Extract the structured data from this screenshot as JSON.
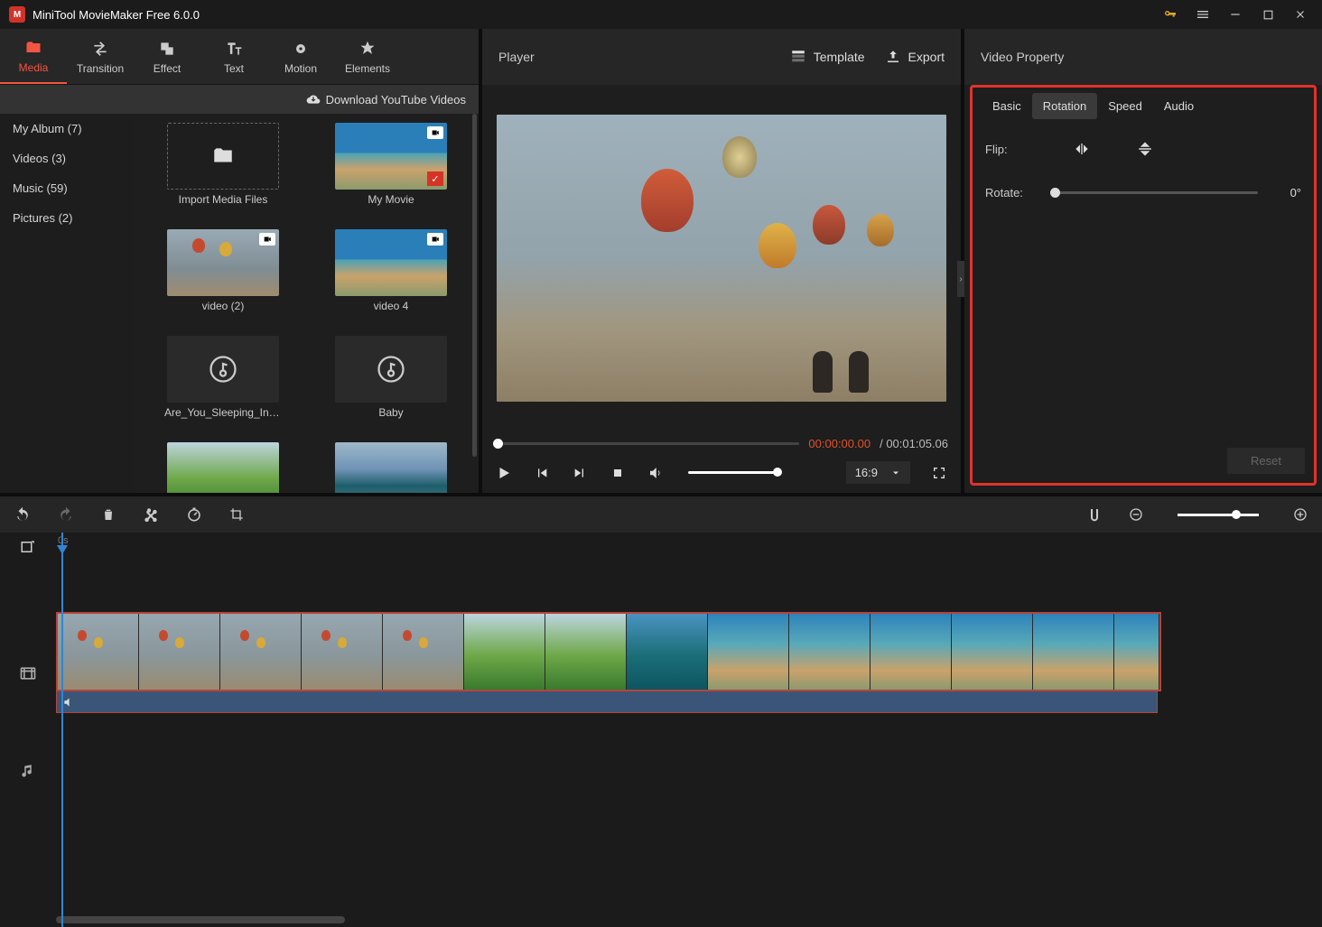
{
  "app": {
    "title": "MiniTool MovieMaker Free 6.0.0"
  },
  "tool_tabs": [
    {
      "id": "media",
      "label": "Media"
    },
    {
      "id": "transition",
      "label": "Transition"
    },
    {
      "id": "effect",
      "label": "Effect"
    },
    {
      "id": "text",
      "label": "Text"
    },
    {
      "id": "motion",
      "label": "Motion"
    },
    {
      "id": "elements",
      "label": "Elements"
    }
  ],
  "media": {
    "active_category": "My Album (7)",
    "categories": [
      {
        "label": "My Album (7)"
      },
      {
        "label": "Videos (3)"
      },
      {
        "label": "Music (59)"
      },
      {
        "label": "Pictures (2)"
      }
    ],
    "download_label": "Download YouTube Videos",
    "items": [
      {
        "label": "Import Media Files",
        "type": "import"
      },
      {
        "label": "My Movie",
        "type": "video",
        "checked": true,
        "thumb": "coast"
      },
      {
        "label": "video (2)",
        "type": "video",
        "thumb": "balloon"
      },
      {
        "label": "video 4",
        "type": "video",
        "thumb": "coast"
      },
      {
        "label": "Are_You_Sleeping_Instrumental",
        "type": "audio"
      },
      {
        "label": "Baby",
        "type": "audio"
      },
      {
        "label": "",
        "type": "picture",
        "thumb": "green"
      },
      {
        "label": "",
        "type": "picture",
        "thumb": "lake"
      }
    ]
  },
  "player": {
    "title": "Player",
    "template_label": "Template",
    "export_label": "Export",
    "current_time": "00:00:00.00",
    "total_time": "/ 00:01:05.06",
    "aspect": "16:9"
  },
  "property": {
    "title": "Video Property",
    "tabs": [
      "Basic",
      "Rotation",
      "Speed",
      "Audio"
    ],
    "active_tab": "Rotation",
    "flip_label": "Flip:",
    "rotate_label": "Rotate:",
    "rotate_value": "0°",
    "reset_label": "Reset"
  },
  "timeline": {
    "zero_label": "0s"
  }
}
